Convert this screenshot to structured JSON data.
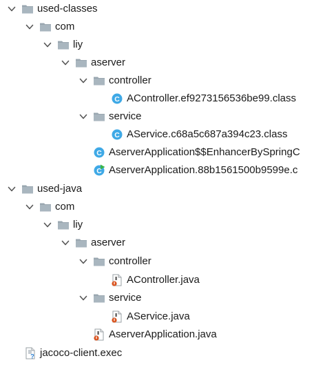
{
  "tree": {
    "used_classes": {
      "label": "used-classes",
      "com": {
        "label": "com",
        "liy": {
          "label": "liy",
          "aserver": {
            "label": "aserver",
            "controller": {
              "label": "controller",
              "file": "AController.ef9273156536be99.class"
            },
            "service": {
              "label": "service",
              "file": "AService.c68a5c687a394c23.class"
            },
            "enhancer_file": "AserverApplication$$EnhancerBySpringC",
            "app_file": "AserverApplication.88b1561500b9599e.c"
          }
        }
      }
    },
    "used_java": {
      "label": "used-java",
      "com": {
        "label": "com",
        "liy": {
          "label": "liy",
          "aserver": {
            "label": "aserver",
            "controller": {
              "label": "controller",
              "file": "AController.java"
            },
            "service": {
              "label": "service",
              "file": "AService.java"
            },
            "app_file": "AserverApplication.java"
          }
        }
      }
    },
    "root_file": "jacoco-client.exec"
  },
  "icons": {
    "chevron": "chevron-down-icon",
    "folder": "folder-icon",
    "class_file": "class-file-icon",
    "runnable_class_file": "runnable-class-file-icon",
    "java_file": "java-file-icon",
    "unknown_file": "unknown-file-icon"
  },
  "colors": {
    "folder": "#9aa7b0",
    "class_icon": "#3fa9e6",
    "java_icon": "#d9531e",
    "run_badge": "#39b54a"
  }
}
